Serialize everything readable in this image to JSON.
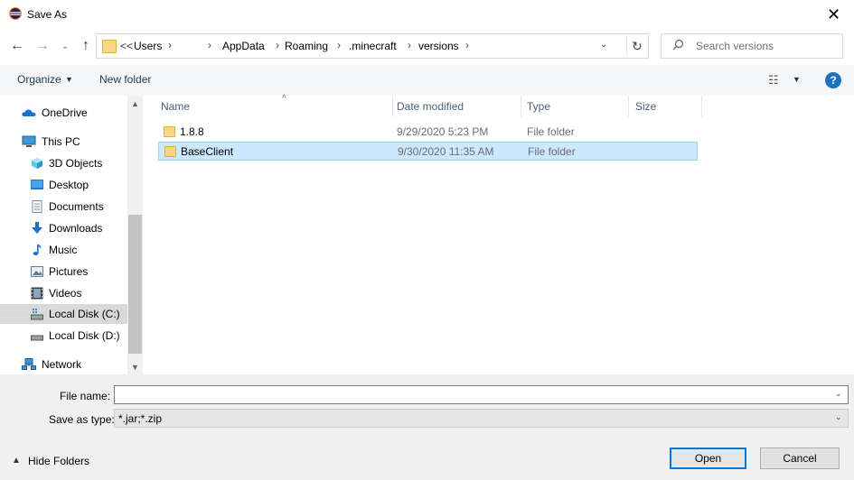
{
  "window": {
    "title": "Save As"
  },
  "address": {
    "overflow": "<<",
    "crumbs": [
      "Users",
      "AppData",
      "Roaming",
      ".minecraft",
      "versions"
    ]
  },
  "search": {
    "placeholder": "Search versions"
  },
  "toolbar": {
    "organize_label": "Organize",
    "new_folder_label": "New folder",
    "help_label": "?"
  },
  "nav": {
    "items": [
      {
        "label": "OneDrive",
        "icon": "cloud-icon"
      },
      {
        "label": "This PC",
        "icon": "computer-icon"
      },
      {
        "label": "3D Objects",
        "icon": "cube-icon"
      },
      {
        "label": "Desktop",
        "icon": "desktop-icon"
      },
      {
        "label": "Documents",
        "icon": "document-icon"
      },
      {
        "label": "Downloads",
        "icon": "download-arrow-icon"
      },
      {
        "label": "Music",
        "icon": "music-note-icon"
      },
      {
        "label": "Pictures",
        "icon": "picture-icon"
      },
      {
        "label": "Videos",
        "icon": "film-icon"
      },
      {
        "label": "Local Disk (C:)",
        "icon": "drive-icon"
      },
      {
        "label": "Local Disk (D:)",
        "icon": "drive-icon"
      },
      {
        "label": "Network",
        "icon": "network-icon"
      }
    ]
  },
  "columns": {
    "name": "Name",
    "date": "Date modified",
    "type": "Type",
    "size": "Size"
  },
  "files": [
    {
      "name": "1.8.8",
      "date": "9/29/2020 5:23 PM",
      "type": "File folder"
    },
    {
      "name": "BaseClient",
      "date": "9/30/2020 11:35 AM",
      "type": "File folder"
    }
  ],
  "form": {
    "filename_label": "File name:",
    "filename_value": "",
    "savetype_label": "Save as type:",
    "savetype_value": "*.jar;*.zip"
  },
  "footer": {
    "hide_folders_label": "Hide Folders",
    "open_label": "Open",
    "cancel_label": "Cancel"
  },
  "colors": {
    "selection": "#cce8ff",
    "accent": "#0078d7",
    "folder": "#f9d77e"
  }
}
